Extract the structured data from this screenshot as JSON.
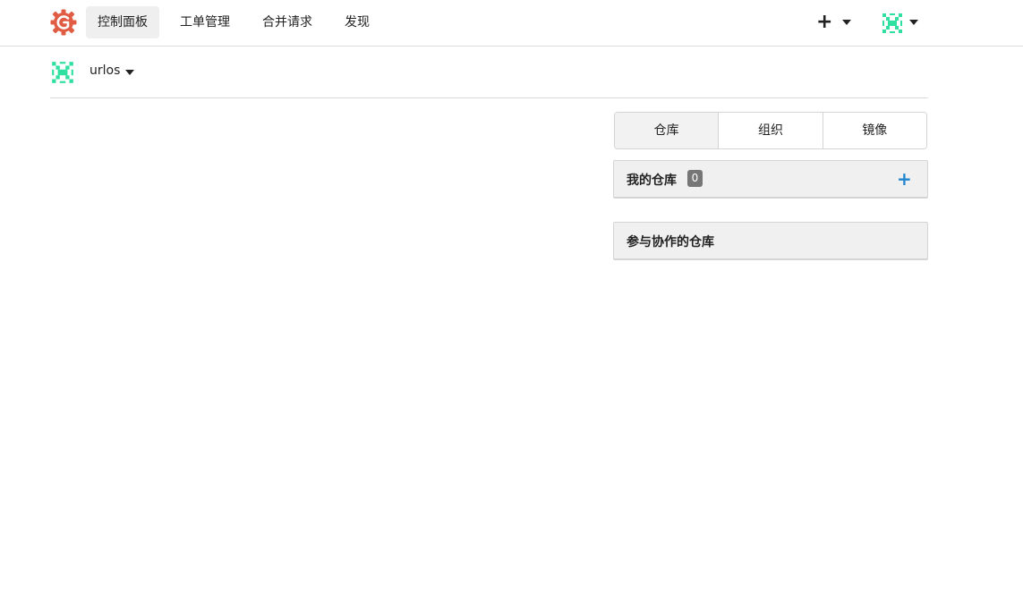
{
  "nav": {
    "items": [
      {
        "label": "控制面板",
        "active": true
      },
      {
        "label": "工单管理",
        "active": false
      },
      {
        "label": "合并请求",
        "active": false
      },
      {
        "label": "发现",
        "active": false
      }
    ],
    "plus_label": "+"
  },
  "context": {
    "username": "urlos"
  },
  "tabs": [
    {
      "label": "仓库",
      "active": true
    },
    {
      "label": "组织",
      "active": false
    },
    {
      "label": "镜像",
      "active": false
    }
  ],
  "panels": {
    "my_repos": {
      "title": "我的仓库",
      "count": "0",
      "add_label": "+"
    },
    "collab_repos": {
      "title": "参与协作的仓库"
    }
  },
  "colors": {
    "logo": "#e05d44",
    "avatar": "#2fe0a0",
    "accent": "#2185d0",
    "badge": "#767676"
  },
  "icons": {
    "logo": "gitea-logo-icon",
    "avatar": "identicon-avatar-icon",
    "caret": "caret-down-icon",
    "plus": "plus-icon"
  }
}
